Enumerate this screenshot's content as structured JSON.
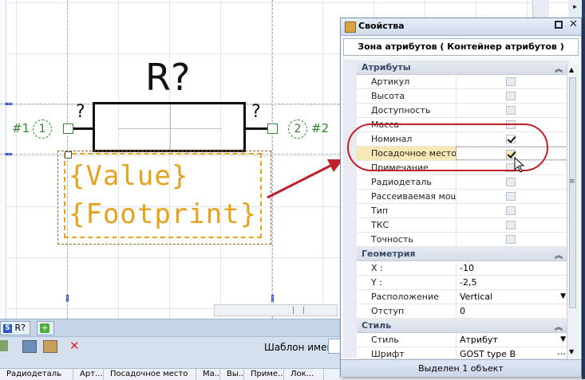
{
  "schematic": {
    "refdes": "R?",
    "pin_q_left": "?",
    "pin_q_right": "?",
    "pin1_label": "#1",
    "pin1_number": "1",
    "pin2_label": "#2",
    "pin2_number": "2",
    "attr_value": "{Value}",
    "attr_footprint": "{Footprint}"
  },
  "tabs": [
    {
      "label": "R?"
    }
  ],
  "filter": {
    "label": "Шаблон имен"
  },
  "grid_columns": [
    "Радиодеталь",
    "Арт...",
    "Посадочное место",
    "Ма...",
    "Вы...",
    "Приме...",
    "Лок..."
  ],
  "panel": {
    "title": "Свойства",
    "object_header": "Зона атрибутов ( Контейнер атрибутов )",
    "status": "Выделен 1 объект",
    "sections": {
      "attributes": {
        "title": "Атрибуты",
        "items": [
          {
            "name": "Артикул",
            "checked": false
          },
          {
            "name": "Высота",
            "checked": false
          },
          {
            "name": "Доступность",
            "checked": false
          },
          {
            "name": "Масса",
            "checked": false
          },
          {
            "name": "Номинал",
            "checked": true
          },
          {
            "name": "Посадочное место",
            "checked": true
          },
          {
            "name": "Примечание",
            "checked": false
          },
          {
            "name": "Радиодеталь",
            "checked": false
          },
          {
            "name": "Рассеиваемая мощно",
            "checked": false
          },
          {
            "name": "Тип",
            "checked": false
          },
          {
            "name": "ТКС",
            "checked": false
          },
          {
            "name": "Точность",
            "checked": false
          }
        ]
      },
      "geometry": {
        "title": "Геометрия",
        "items": [
          {
            "name": "X :",
            "value": "-10"
          },
          {
            "name": "Y :",
            "value": "-2,5"
          },
          {
            "name": "Расположение",
            "value": "Vertical"
          },
          {
            "name": "Отступ",
            "value": "0"
          }
        ]
      },
      "style": {
        "title": "Стиль",
        "items": [
          {
            "name": "Стиль",
            "value": "Атрибут"
          },
          {
            "name": "Шрифт",
            "value": "GOST type B"
          }
        ]
      }
    }
  },
  "colors": {
    "highlight": "#f7e9b5",
    "annotation": "#c0202a",
    "pin": "#2d8a2d",
    "attribute_text": "#e6a21c"
  }
}
